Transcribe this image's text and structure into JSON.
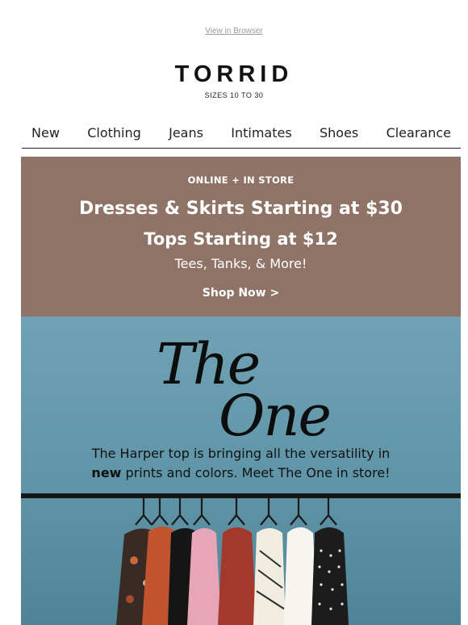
{
  "header": {
    "view_in_browser": "View in Browser",
    "logo": "TORRID",
    "tagline": "SIZES 10 TO 30"
  },
  "nav": {
    "items": [
      "New",
      "Clothing",
      "Jeans",
      "Intimates",
      "Shoes",
      "Clearance"
    ]
  },
  "promo": {
    "eyebrow": "ONLINE + IN STORE",
    "headline_1": "Dresses & Skirts Starting at $30",
    "headline_2": "Tops Starting at $12",
    "subline": "Tees, Tanks, & More!",
    "cta": "Shop Now >",
    "background_color": "#8f7366"
  },
  "hero": {
    "title_line_1": "The",
    "title_line_2": "One",
    "copy_part_1": "The Harper top is bringing all the versatility in",
    "copy_bold": "new",
    "copy_part_2": "prints and colors. Meet The One in store!",
    "background_color": "#6fa2b4"
  }
}
